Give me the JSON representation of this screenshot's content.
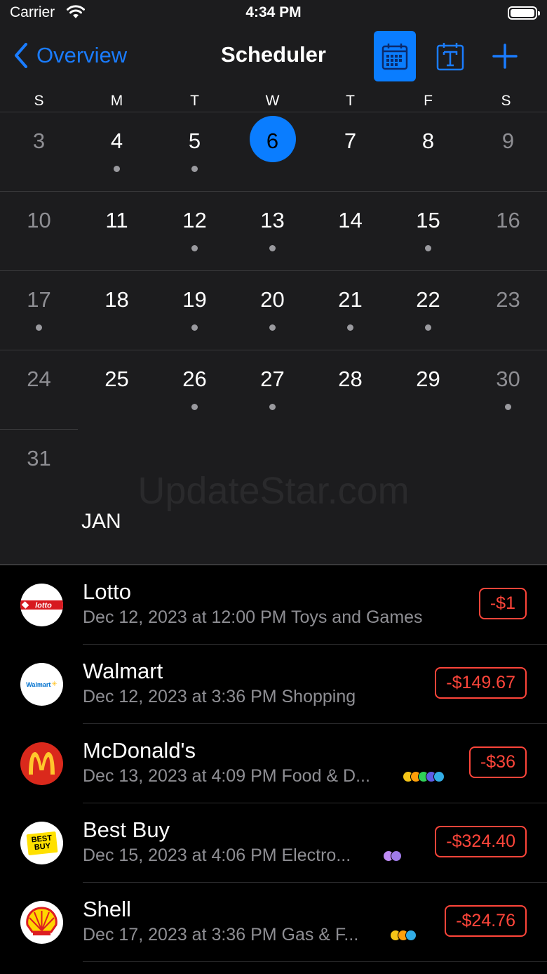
{
  "status_bar": {
    "carrier": "Carrier",
    "time": "4:34 PM"
  },
  "nav": {
    "back_label": "Overview",
    "title": "Scheduler",
    "calendar_view_icon": "calendar-grid-icon",
    "text_view_icon": "text-t-icon",
    "add_icon": "plus-icon",
    "accent": "#0a7dff"
  },
  "weekdays": [
    "S",
    "M",
    "T",
    "W",
    "T",
    "F",
    "S"
  ],
  "calendar": {
    "weeks": [
      [
        {
          "d": "3",
          "dot": false
        },
        {
          "d": "4",
          "dot": true
        },
        {
          "d": "5",
          "dot": true
        },
        {
          "d": "6",
          "dot": false,
          "selected": true
        },
        {
          "d": "7",
          "dot": false
        },
        {
          "d": "8",
          "dot": false
        },
        {
          "d": "9",
          "dot": false
        }
      ],
      [
        {
          "d": "10",
          "dot": false
        },
        {
          "d": "11",
          "dot": false
        },
        {
          "d": "12",
          "dot": true
        },
        {
          "d": "13",
          "dot": true
        },
        {
          "d": "14",
          "dot": false
        },
        {
          "d": "15",
          "dot": true
        },
        {
          "d": "16",
          "dot": false
        }
      ],
      [
        {
          "d": "17",
          "dot": true
        },
        {
          "d": "18",
          "dot": false
        },
        {
          "d": "19",
          "dot": true
        },
        {
          "d": "20",
          "dot": true
        },
        {
          "d": "21",
          "dot": true
        },
        {
          "d": "22",
          "dot": true
        },
        {
          "d": "23",
          "dot": false
        }
      ],
      [
        {
          "d": "24",
          "dot": false
        },
        {
          "d": "25",
          "dot": false
        },
        {
          "d": "26",
          "dot": true
        },
        {
          "d": "27",
          "dot": true
        },
        {
          "d": "28",
          "dot": false
        },
        {
          "d": "29",
          "dot": false
        },
        {
          "d": "30",
          "dot": true
        }
      ],
      [
        {
          "d": "31",
          "dot": false
        }
      ]
    ],
    "next_month_label": "JAN",
    "watermark": "UpdateStar.com"
  },
  "transactions": [
    {
      "name": "Lotto",
      "subtitle": "Dec 12, 2023 at 12:00 PM Toys and Games",
      "amount": "-$1",
      "logo_icon": "lotto-logo-icon",
      "tags": []
    },
    {
      "name": "Walmart",
      "subtitle": "Dec 12, 2023 at 3:36 PM Shopping",
      "amount": "-$149.67",
      "logo_icon": "walmart-logo-icon",
      "logo_text": "Walmart",
      "tags": []
    },
    {
      "name": "McDonald's",
      "subtitle": "Dec 13, 2023 at 4:09 PM Food & D...",
      "amount": "-$36",
      "logo_icon": "mcdonalds-logo-icon",
      "tags": [
        "#f5c518",
        "#ff9f0a",
        "#30d158",
        "#5e5ce6",
        "#32ade6"
      ]
    },
    {
      "name": "Best Buy",
      "subtitle": "Dec 15, 2023 at 4:06 PM Electro...",
      "amount": "-$324.40",
      "logo_icon": "bestbuy-logo-icon",
      "logo_text": "BEST BUY",
      "tags": [
        "#bf8cf5",
        "#a07be8"
      ]
    },
    {
      "name": "Shell",
      "subtitle": "Dec 17, 2023 at 3:36 PM Gas & F...",
      "amount": "-$24.76",
      "logo_icon": "shell-logo-icon",
      "tags": [
        "#f5c518",
        "#ff9f0a",
        "#32ade6"
      ]
    }
  ]
}
